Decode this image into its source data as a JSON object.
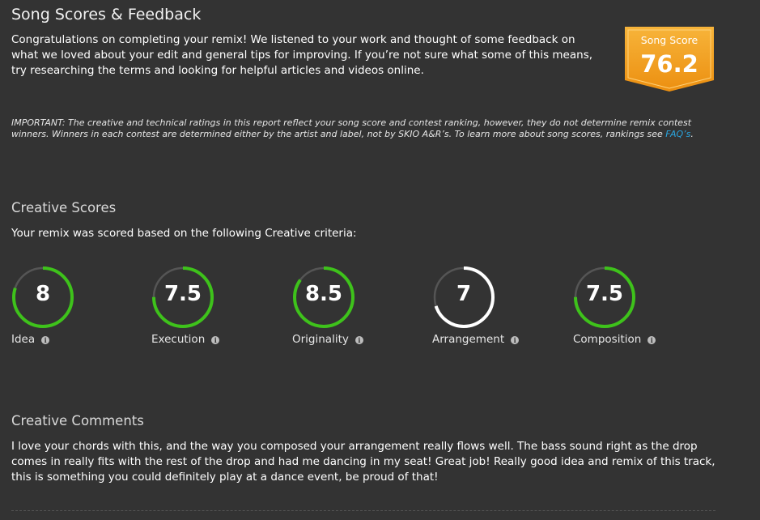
{
  "header": {
    "title": "Song Scores & Feedback",
    "intro": "Congratulations on completing your remix! We listened to your work and thought of some feedback on what we loved about your edit and general tips for improving. If you’re not sure what some of this means, try researching the terms and looking for helpful articles and videos online."
  },
  "song_score": {
    "label": "Song Score",
    "value": "76.2",
    "color": "#f5a623"
  },
  "notice": {
    "text": "IMPORTANT: The creative and technical ratings in this report reflect your song score and contest ranking, however, they do not determine remix contest winners. Winners in each contest are determined either by the artist and label, not by SKIO A&R’s. To learn more about song scores, rankings see ",
    "link": "FAQ’s",
    "suffix": "."
  },
  "creative_scores": {
    "title": "Creative Scores",
    "subtitle": "Your remix was scored based on the following Creative criteria:",
    "items": [
      {
        "label": "Idea",
        "value": "8",
        "fraction": 0.8,
        "color": "#3ec21b",
        "icon": "info-icon"
      },
      {
        "label": "Execution",
        "value": "7.5",
        "fraction": 0.75,
        "color": "#3ec21b",
        "icon": "info-icon"
      },
      {
        "label": "Originality",
        "value": "8.5",
        "fraction": 0.85,
        "color": "#3ec21b",
        "icon": "info-icon"
      },
      {
        "label": "Arrangement",
        "value": "7",
        "fraction": 0.7,
        "color": "#ffffff",
        "icon": "info-icon"
      },
      {
        "label": "Composition",
        "value": "7.5",
        "fraction": 0.75,
        "color": "#3ec21b",
        "icon": "info-icon"
      }
    ]
  },
  "creative_comments": {
    "title": "Creative Comments",
    "text": "I love your chords with this, and the way you composed your arrangement really flows well. The bass sound right as the drop comes in really fits with the rest of the drop and had me dancing in my seat! Great job! Really good idea and remix of this track, this is something you could definitely play at a dance event, be proud of that!"
  }
}
